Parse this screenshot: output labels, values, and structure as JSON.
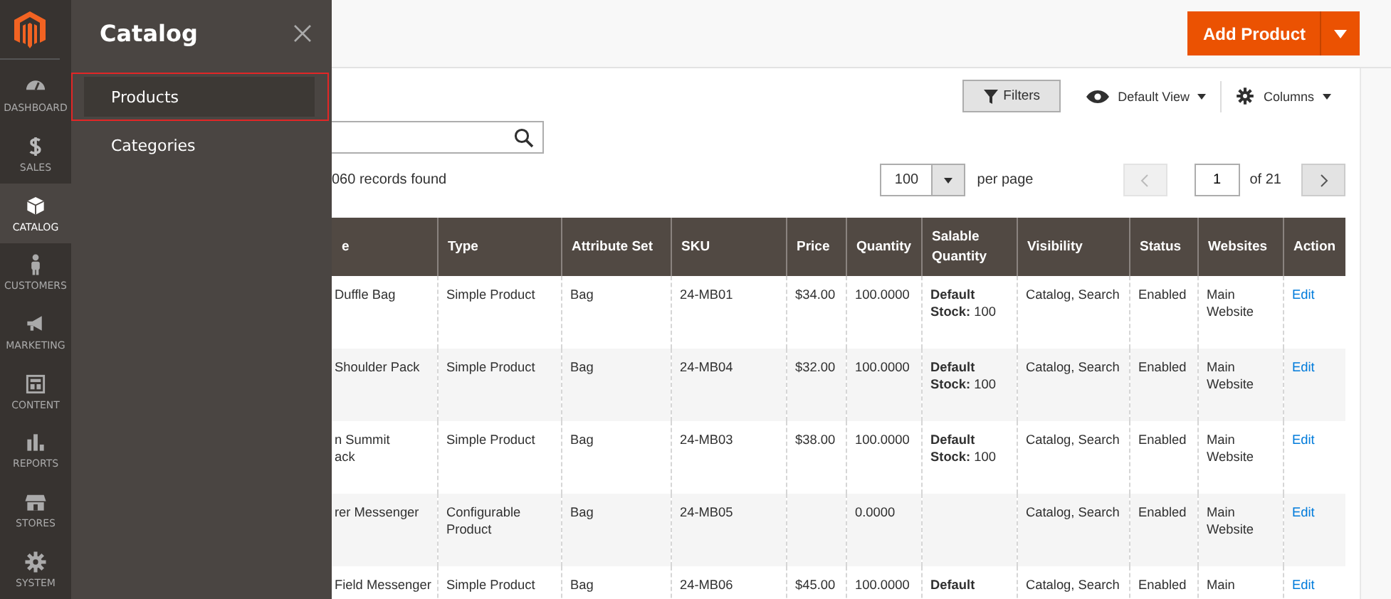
{
  "nav": {
    "items": [
      {
        "label": "DASHBOARD",
        "selected": false
      },
      {
        "label": "SALES",
        "selected": false
      },
      {
        "label": "CATALOG",
        "selected": true
      },
      {
        "label": "CUSTOMERS",
        "selected": false
      },
      {
        "label": "MARKETING",
        "selected": false
      },
      {
        "label": "CONTENT",
        "selected": false
      },
      {
        "label": "REPORTS",
        "selected": false
      },
      {
        "label": "STORES",
        "selected": false
      },
      {
        "label": "SYSTEM",
        "selected": false
      }
    ]
  },
  "flyout": {
    "title": "Catalog",
    "items": [
      {
        "label": "Products",
        "selected": true
      },
      {
        "label": "Categories",
        "selected": false
      }
    ]
  },
  "header": {
    "primary_button": "Add Product"
  },
  "toolbar": {
    "filters": "Filters",
    "view": "Default View",
    "columns": "Columns"
  },
  "records": "060 records found",
  "pager": {
    "per_page_value": "100",
    "per_page_label": "per page",
    "page": "1",
    "of": "of 21"
  },
  "table": {
    "columns": [
      "e",
      "Type",
      "Attribute Set",
      "SKU",
      "Price",
      "Quantity",
      "Salable Quantity",
      "Visibility",
      "Status",
      "Websites",
      "Action"
    ],
    "rows": [
      [
        "Duffle Bag",
        "Simple Product",
        "Bag",
        "24-MB01",
        "$34.00",
        "100.0000",
        "**Default Stock:** 100",
        "Catalog, Search",
        "Enabled",
        "Main Website",
        "Edit"
      ],
      [
        "Shoulder Pack",
        "Simple Product",
        "Bag",
        "24-MB04",
        "$32.00",
        "100.0000",
        "**Default Stock:** 100",
        "Catalog, Search",
        "Enabled",
        "Main Website",
        "Edit"
      ],
      [
        "n Summit\nack",
        "Simple Product",
        "Bag",
        "24-MB03",
        "$38.00",
        "100.0000",
        "**Default Stock:** 100",
        "Catalog, Search",
        "Enabled",
        "Main Website",
        "Edit"
      ],
      [
        "rer Messenger",
        "Configurable Product",
        "Bag",
        "24-MB05",
        "",
        "0.0000",
        "",
        "Catalog, Search",
        "Enabled",
        "Main Website",
        "Edit"
      ],
      [
        "Field Messenger",
        "Simple Product",
        "Bag",
        "24-MB06",
        "$45.00",
        "100.0000",
        "**Default**",
        "Catalog, Search",
        "Enabled",
        "Main",
        "Edit"
      ]
    ]
  }
}
